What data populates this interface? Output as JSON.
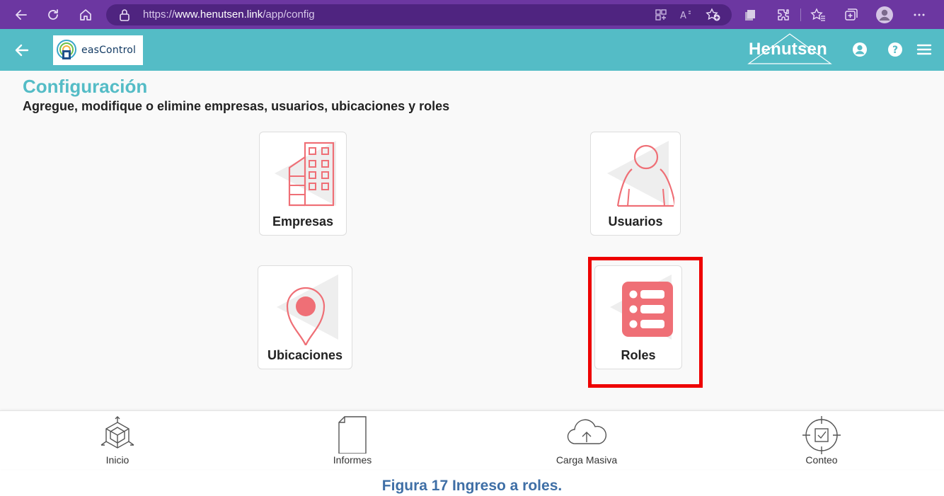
{
  "browser": {
    "url_prefix": "https://",
    "url_host": "www.henutsen.link",
    "url_path": "/app/config",
    "accent_color": "#6c37a1",
    "icons": [
      "back-arrow-icon",
      "refresh-icon",
      "home-icon",
      "lock-icon",
      "app-grid-icon",
      "read-aloud-icon",
      "add-favorite-icon",
      "collections-icon",
      "extensions-icon",
      "favorites-icon",
      "tab-groups-icon",
      "profile-avatar-icon",
      "more-options-icon"
    ]
  },
  "header": {
    "logo_text": "easControl",
    "brand": "Henutsen",
    "color": "#54bcc6",
    "icons": [
      "back-arrow-icon",
      "user-account-icon",
      "help-icon",
      "hamburger-menu-icon"
    ]
  },
  "page": {
    "title": "Configuración",
    "subtitle": "Agregue, modifique o elimine empresas, usuarios,  ubicaciones y roles"
  },
  "tiles": [
    {
      "label": "Empresas",
      "icon": "building-icon"
    },
    {
      "label": "Usuarios",
      "icon": "user-icon"
    },
    {
      "label": "Ubicaciones",
      "icon": "location-pin-icon"
    },
    {
      "label": "Roles",
      "icon": "list-icon",
      "highlighted": true
    }
  ],
  "tile_icon_color": "#ef6f76",
  "highlight_color": "#ee0000",
  "bottom_nav": [
    {
      "label": "Inicio",
      "icon": "cube-icon"
    },
    {
      "label": "Informes",
      "icon": "document-icon"
    },
    {
      "label": "Carga Masiva",
      "icon": "cloud-upload-icon"
    },
    {
      "label": "Conteo",
      "icon": "target-check-icon"
    }
  ],
  "caption": "Figura 17 Ingreso a roles."
}
